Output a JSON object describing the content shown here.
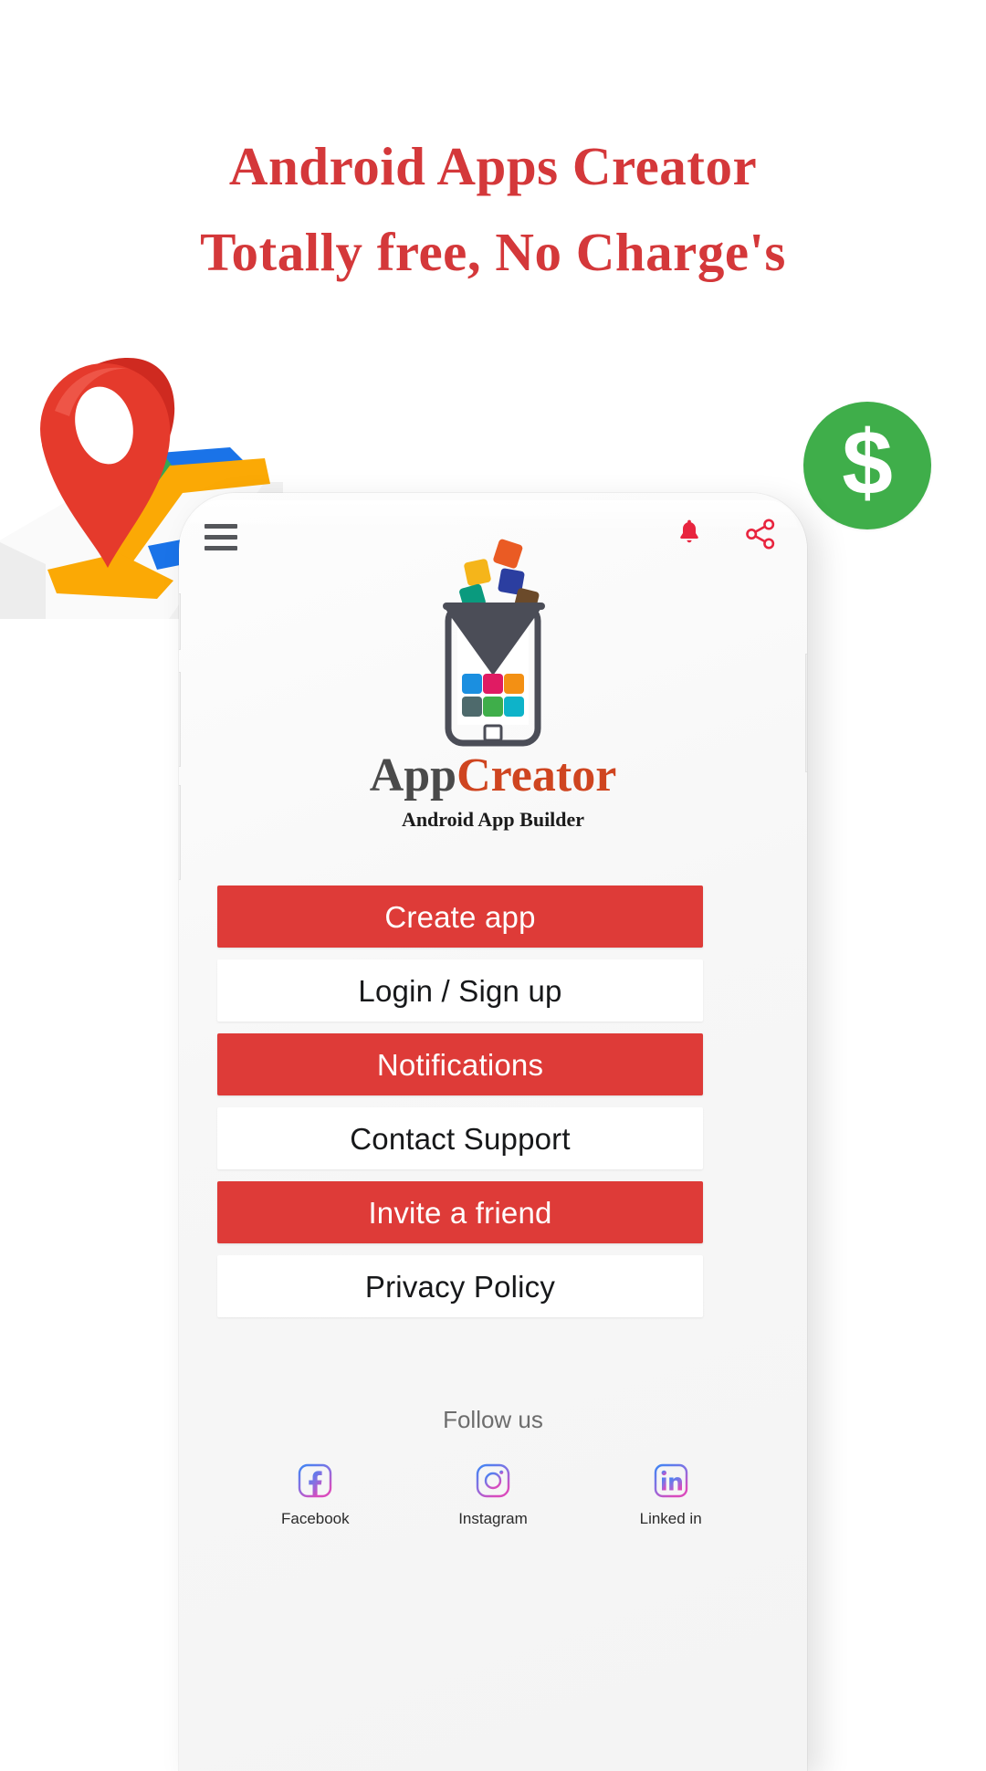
{
  "promo": {
    "headline_line1": "Android Apps Creator",
    "headline_line2": "Totally free, No Charge's",
    "headline_color": "#d4383a",
    "map_icon": "map-pin-icon",
    "money_icon": "dollar-badge-icon",
    "money_glyph": "$",
    "money_color": "#3FAE4A"
  },
  "phone": {
    "topbar": {
      "menu_icon": "hamburger-menu-icon",
      "bell_icon": "notification-bell-icon",
      "share_icon": "share-icon",
      "icon_color": "#e8253f"
    },
    "logo": {
      "icon": "appcreator-logo-icon",
      "brand_part1": "App",
      "brand_part2": "Creator",
      "brand_part1_color": "#4a4a4a",
      "brand_part2_color": "#cf4520",
      "tagline": "Android App Builder"
    },
    "menu_buttons": [
      {
        "label": "Create app",
        "style": "primary"
      },
      {
        "label": "Login / Sign up",
        "style": "secondary"
      },
      {
        "label": "Notifications",
        "style": "primary"
      },
      {
        "label": "Contact Support",
        "style": "secondary"
      },
      {
        "label": "Invite a friend",
        "style": "primary"
      },
      {
        "label": "Privacy Policy",
        "style": "secondary"
      }
    ],
    "primary_color": "#de3b38",
    "follow": {
      "label": "Follow us",
      "items": [
        {
          "label": "Facebook",
          "icon": "facebook-icon"
        },
        {
          "label": "Instagram",
          "icon": "instagram-icon"
        },
        {
          "label": "Linked in",
          "icon": "linkedin-icon"
        }
      ]
    }
  }
}
